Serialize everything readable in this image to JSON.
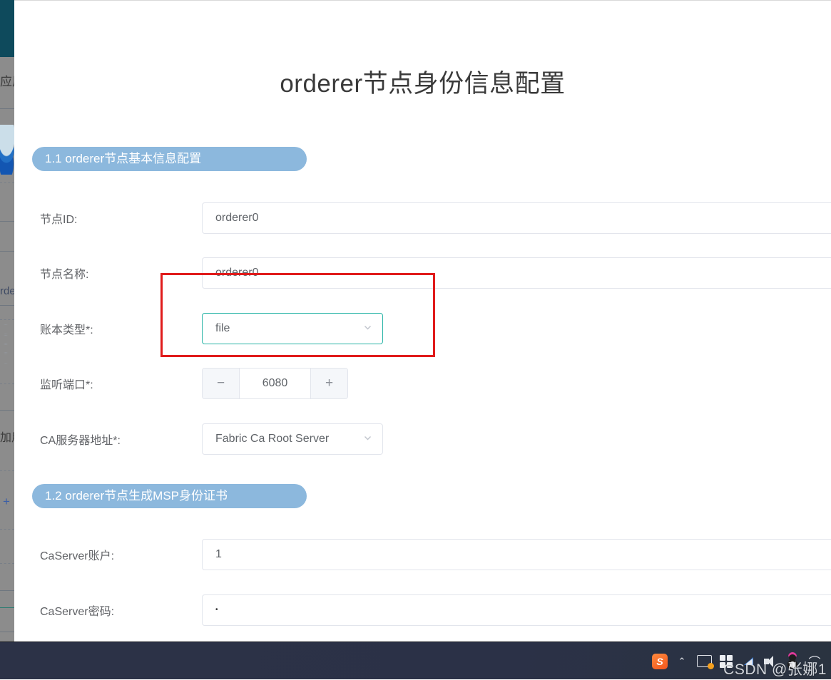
{
  "page": {
    "title": "orderer节点身份信息配置"
  },
  "sections": [
    {
      "banner": "1.1 orderer节点基本信息配置"
    },
    {
      "banner": "1.2 orderer节点生成MSP身份证书"
    }
  ],
  "fields": {
    "node_id": {
      "label": "节点ID:",
      "value": "orderer0"
    },
    "node_name": {
      "label": "节点名称:",
      "value": "orderer0"
    },
    "ledger_type": {
      "label": "账本类型*:",
      "value": "file",
      "icon": "chevron-down-icon",
      "focused": true,
      "focus_color": "#28b4a6"
    },
    "listen_port": {
      "label": "监听端口*:",
      "value": "6080",
      "decrement_label": "−",
      "increment_label": "+"
    },
    "ca_server_address": {
      "label": "CA服务器地址*:",
      "value": "Fabric Ca Root Server",
      "icon": "chevron-down-icon"
    },
    "ca_server_account": {
      "label": "CaServer账户:",
      "value": "1"
    },
    "ca_server_password": {
      "label": "CaServer密码:",
      "value": "•"
    }
  },
  "annotation": {
    "name": "red-highlight-rectangle",
    "color": "#e01b1b"
  },
  "background_window": {
    "text_a": "应用",
    "text_b": "rde",
    "text_c": "加用",
    "plus": "+"
  },
  "taskbar": {
    "background_color": "#2b3147",
    "tray": [
      {
        "name": "sogou-input-icon",
        "label": "S"
      },
      {
        "name": "show-hidden-icons-icon",
        "label": "⌃"
      },
      {
        "name": "display-monitor-icon",
        "label": ""
      },
      {
        "name": "windows-security-icon",
        "label": ""
      },
      {
        "name": "network-icon",
        "label": ""
      },
      {
        "name": "volume-icon",
        "label": ""
      },
      {
        "name": "qq-penguin-icon",
        "label": ""
      },
      {
        "name": "wifi-icon",
        "label": "⌒"
      }
    ],
    "watermark": "CSDN @张娜1"
  }
}
